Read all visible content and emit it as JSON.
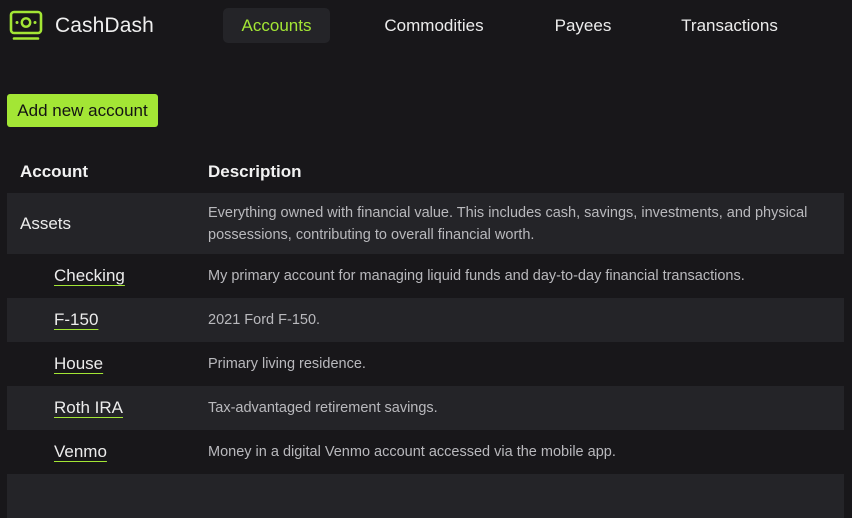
{
  "app": {
    "brand_name": "CashDash",
    "brand_icon": "banknote-icon",
    "accent_color": "#a3e635"
  },
  "nav": {
    "items": [
      {
        "label": "Accounts",
        "active": true
      },
      {
        "label": "Commodities",
        "active": false
      },
      {
        "label": "Payees",
        "active": false
      },
      {
        "label": "Transactions",
        "active": false
      }
    ]
  },
  "actions": {
    "add_account_label": "Add new account"
  },
  "table": {
    "headers": {
      "account": "Account",
      "description": "Description"
    },
    "rows": [
      {
        "name": "Assets",
        "description": "Everything owned with financial value. This includes cash, savings, investments, and physical possessions, contributing to overall financial worth.",
        "is_group": true
      },
      {
        "name": "Checking",
        "description": "My primary account for managing liquid funds and day-to-day financial transactions.",
        "is_group": false
      },
      {
        "name": "F-150",
        "description": "2021 Ford F-150.",
        "is_group": false
      },
      {
        "name": "House",
        "description": "Primary living residence.",
        "is_group": false
      },
      {
        "name": "Roth IRA",
        "description": "Tax-advantaged retirement savings.",
        "is_group": false
      },
      {
        "name": "Venmo",
        "description": "Money in a digital Venmo account accessed via the mobile app.",
        "is_group": false
      }
    ]
  }
}
